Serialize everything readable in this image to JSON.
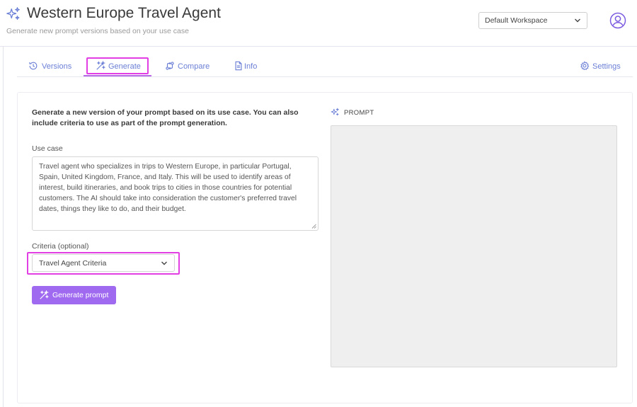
{
  "header": {
    "title": "Western Europe Travel Agent",
    "subtitle": "Generate new prompt versions based on your use case",
    "workspace_label": "Default Workspace"
  },
  "tabs": [
    {
      "label": "Versions",
      "icon": "history-icon"
    },
    {
      "label": "Generate",
      "icon": "magic-wand-icon",
      "active": true
    },
    {
      "label": "Compare",
      "icon": "compare-icon"
    },
    {
      "label": "Info",
      "icon": "document-icon"
    },
    {
      "label": "Settings",
      "icon": "gear-icon"
    }
  ],
  "form": {
    "intro": "Generate a new version of your prompt based on its use case. You can also include criteria to use as part of the prompt generation.",
    "use_case_label": "Use case",
    "use_case_value": "Travel agent who specializes in trips to Western Europe, in particular Portugal, Spain, United Kingdom, France, and Italy. This will be used to identify areas of interest, build itineraries, and book trips to cities in those countries for potential customers. The AI should take into consideration the customer's preferred travel dates, things they like to do, and their budget.",
    "criteria_label": "Criteria (optional)",
    "criteria_value": "Travel Agent Criteria",
    "generate_label": "Generate prompt"
  },
  "prompt": {
    "heading": "PROMPT",
    "value": ""
  },
  "colors": {
    "accent": "#a06af0",
    "tab_text": "#6b7fd6",
    "highlight": "#e13fe3"
  }
}
